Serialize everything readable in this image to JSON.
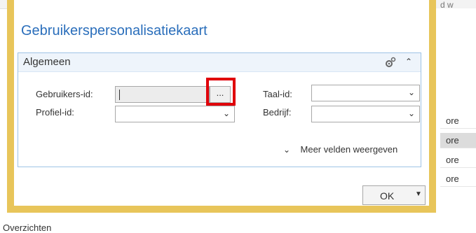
{
  "background": {
    "top_right_text": "d w",
    "rows": [
      "ore",
      "ore",
      "ore",
      "ore"
    ],
    "bottom_text": "Overzichten"
  },
  "dialog": {
    "title": "Gebruikerspersonalisatiekaart",
    "section": {
      "title": "Algemeen",
      "fields": {
        "user_id_label": "Gebruikers-id:",
        "user_id_value": "",
        "lookup_label": "...",
        "language_label": "Taal-id:",
        "language_value": "",
        "profile_label": "Profiel-id:",
        "profile_value": "",
        "company_label": "Bedrijf:",
        "company_value": ""
      },
      "more_fields_label": "Meer velden weergeven"
    },
    "ok_label": "OK"
  },
  "colors": {
    "title_blue": "#2a6ebb",
    "frame_yellow": "#e8c55a",
    "highlight_red": "#e0000a"
  }
}
